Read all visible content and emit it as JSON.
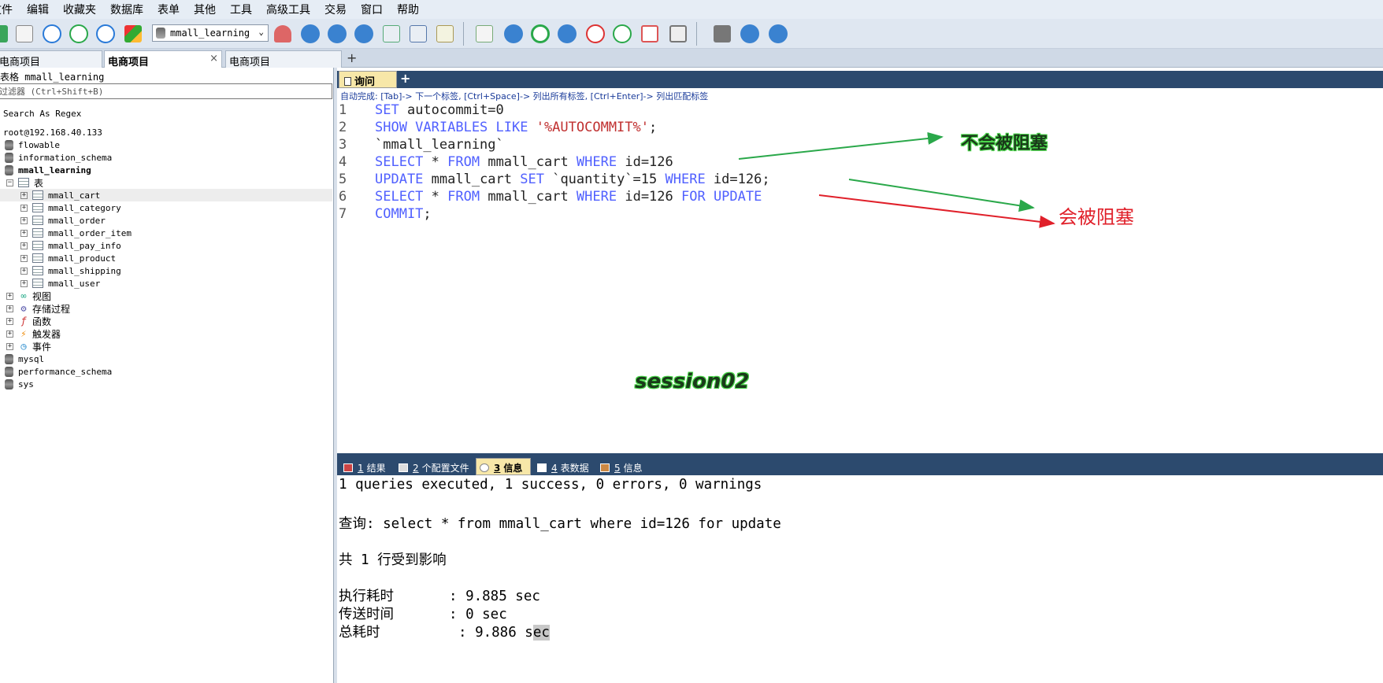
{
  "menu": [
    "文件",
    "编辑",
    "收藏夹",
    "数据库",
    "表单",
    "其他",
    "工具",
    "高级工具",
    "交易",
    "窗口",
    "帮助"
  ],
  "toolbar": {
    "db_selected": "mmall_learning"
  },
  "conn_tabs": [
    "电商项目",
    "电商项目",
    "电商项目"
  ],
  "sidebar": {
    "filter_label": "筛选表格 mmall_learning",
    "filter_placeholder": "过滤器 (Ctrl+Shift+B)",
    "regex_label": "Search As Regex",
    "server": "root@192.168.40.133",
    "dbs_top": [
      "flowable",
      "information_schema"
    ],
    "current_db": "mmall_learning",
    "tables_label": "表",
    "tables": [
      "mmall_cart",
      "mmall_category",
      "mmall_order",
      "mmall_order_item",
      "mmall_pay_info",
      "mmall_product",
      "mmall_shipping",
      "mmall_user"
    ],
    "groups": [
      "视图",
      "存储过程",
      "函数",
      "触发器",
      "事件"
    ],
    "dbs_bottom": [
      "mysql",
      "performance_schema",
      "sys"
    ]
  },
  "editor": {
    "tab_label": "询问",
    "hint": "自动完成: [Tab]-> 下一个标签, [Ctrl+Space]-> 列出所有标签, [Ctrl+Enter]-> 列出匹配标签",
    "lines": [
      {
        "n": "1",
        "parts": [
          [
            "kw",
            "SET"
          ],
          [
            "txt",
            " autocommit=0"
          ]
        ]
      },
      {
        "n": "2",
        "parts": [
          [
            "kw",
            "SHOW VARIABLES LIKE "
          ],
          [
            "str",
            "'%AUTOCOMMIT%'"
          ],
          [
            "txt",
            ";"
          ]
        ]
      },
      {
        "n": "3",
        "parts": [
          [
            "txt",
            "`mmall_learning`"
          ]
        ]
      },
      {
        "n": "4",
        "parts": [
          [
            "kw",
            "SELECT"
          ],
          [
            "txt",
            " * "
          ],
          [
            "kw",
            "FROM"
          ],
          [
            "txt",
            " mmall_cart "
          ],
          [
            "kw",
            "WHERE"
          ],
          [
            "txt",
            " id=126"
          ]
        ]
      },
      {
        "n": "5",
        "parts": [
          [
            "kw",
            "UPDATE"
          ],
          [
            "txt",
            " mmall_cart "
          ],
          [
            "kw",
            "SET"
          ],
          [
            "txt",
            " `quantity`=15 "
          ],
          [
            "kw",
            "WHERE"
          ],
          [
            "txt",
            " id=126;"
          ]
        ]
      },
      {
        "n": "6",
        "parts": [
          [
            "kw",
            "SELECT"
          ],
          [
            "txt",
            " * "
          ],
          [
            "kw",
            "FROM"
          ],
          [
            "txt",
            " mmall_cart "
          ],
          [
            "kw",
            "WHERE"
          ],
          [
            "txt",
            " id=126 "
          ],
          [
            "kw",
            "FOR UPDATE"
          ]
        ]
      },
      {
        "n": "7",
        "parts": [
          [
            "kw",
            "COMMIT"
          ],
          [
            "txt",
            ";"
          ]
        ]
      }
    ]
  },
  "annotations": {
    "not_blocked": "不会被阻塞",
    "blocked": "会被阻塞",
    "session": "session02"
  },
  "result_tabs": [
    {
      "num": "1",
      "label": " 结果"
    },
    {
      "num": "2",
      "label": " 个配置文件"
    },
    {
      "num": "3",
      "label": " 信息"
    },
    {
      "num": "4",
      "label": " 表数据"
    },
    {
      "num": "5",
      "label": " 信息"
    }
  ],
  "output": {
    "summary": "1 queries executed, 1 success, 0 errors, 0 warnings",
    "query": "查询: select * from mmall_cart where id=126 for update",
    "affected": "共 1 行受到影响",
    "exec_label": "执行耗时",
    "exec_value": ": 9.885 sec",
    "send_label": "传送时间",
    "send_value": ": 0 sec",
    "total_label": "总耗时",
    "total_value_pre": ": 9.886 s",
    "total_value_hl": "ec"
  },
  "colors": {
    "keyword": "#5060ff",
    "string": "#c03030",
    "tabbar": "#2c4a6e",
    "arrow_green": "#2aa84a",
    "arrow_red": "#e0202a"
  }
}
